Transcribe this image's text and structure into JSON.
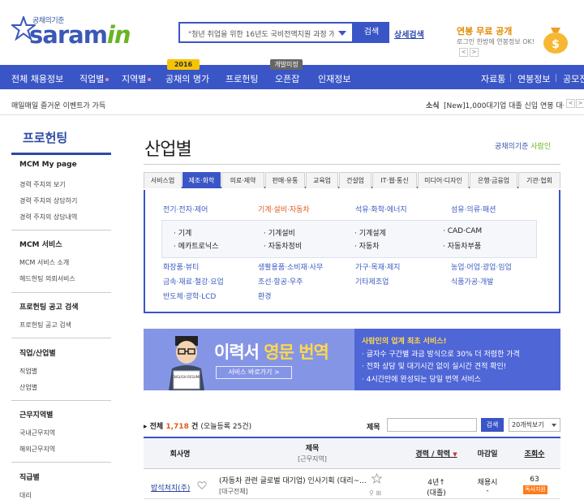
{
  "header": {
    "logo_tagline": "공채의기준",
    "logo_main": "saram",
    "logo_accent": "in",
    "search_value": "\"청년 취업을 위한 16년도 국비전액지원 과정 개설\"",
    "search_button": "검색",
    "detail_search": "상세검색",
    "promo_title": "연봉 무료 공개",
    "promo_sub": "로그인 한방에 연봉정보 OK!",
    "promo_prev": "<",
    "promo_next": ">"
  },
  "nav": {
    "items": [
      "전체 채용정보",
      "직업별",
      "지역별",
      "공채의 명가",
      "프로헌팅",
      "오픈잡",
      "인재정보"
    ],
    "badge_2016": "2016",
    "badge_beta": "개발미정",
    "right_items": [
      "자료통",
      "연봉정보",
      "공모전"
    ]
  },
  "ticker": {
    "left": "매일매일 즐거운 이벤트가 가득",
    "right_label": "소식",
    "right_text": "[New]1,000대기업 대졸 신입 연봉 대공개!",
    "prev": "<",
    "next": ">"
  },
  "sidebar": {
    "title": "프로헌팅",
    "sections": [
      {
        "head": "MCM My page",
        "links": [
          "경력 주치의 보기",
          "경력 주치의 상담하기",
          "경력 주치의 상담내역"
        ]
      },
      {
        "head": "MCM 서비스",
        "links": [
          "MCM 서비스 소개",
          "헤드헌팅 의뢰서비스"
        ]
      },
      {
        "head": "프로헌팅 공고 검색",
        "links": [
          "프로헌팅 공고 검색"
        ]
      },
      {
        "head": "직업/산업별",
        "links": [
          "직업별",
          "산업별"
        ]
      },
      {
        "head": "근무지역별",
        "links": [
          "국내근무지역",
          "해외근무지역"
        ]
      },
      {
        "head": "직급별",
        "links": [
          "대리"
        ]
      }
    ]
  },
  "main": {
    "title": "산업별",
    "brand": "공채의기준",
    "brand_accent": "사람인",
    "tabs": [
      "서비스업",
      "제조·화학",
      "의료·제약",
      "판매·유통",
      "교육업",
      "건설업",
      "IT·웹·통신",
      "미디어·디자인",
      "은행·금융업",
      "기관·협회"
    ],
    "categories_top": [
      "전기·전자·제어",
      "기계·설비·자동차",
      "석유·화학·에너지",
      "섬유·의류·패션"
    ],
    "subcategories": [
      "· 기계",
      "· 기계설비",
      "· 기계설계",
      "· CAD·CAM",
      "· 메카트로닉스",
      "· 자동차정비",
      "· 자동차",
      "· 자동차부품"
    ],
    "categories_bottom": [
      [
        "화장품·뷰티",
        "생활용품·소비재·사무",
        "가구·목재·제지",
        "농업·어업·광업·임업"
      ],
      [
        "금속·재료·철강·요업",
        "조선·항공·우주",
        "기타제조업",
        "식품가공·개발"
      ],
      [
        "반도체·광학·LCD",
        "환경",
        "",
        ""
      ]
    ]
  },
  "banner": {
    "title_white": "이력서",
    "title_yellow": "영문 번역",
    "button": "서비스 바로가기 >",
    "resume_caption": "ENGLISH RESUME",
    "lines": [
      "사람인의 업계 최초 서비스!",
      "· 글자수 구간별 과금 방식으로 30% 더 저렴한 가격",
      "· 전화 상담 및 대기시간 없이 실시간 견적 확인!",
      "· 4시간만에 완성되는 당일 번역 서비스"
    ]
  },
  "list": {
    "total_label": "전체",
    "total_count": "1,718",
    "total_unit": "건",
    "today": "(오늘등록 25건)",
    "search_label": "제목",
    "search_value": "",
    "search_button": "검색",
    "sort_select": "20개씩보기",
    "columns": {
      "company": "회사명",
      "title": "제목",
      "title_sub": "[근무지역]",
      "career": "경력 / 학력",
      "deadline": "마감일",
      "views": "조회수"
    },
    "rows": [
      {
        "company": "밥석쳐치(주)",
        "title": "(자동차 관련 글로벌 대기업) 인사기획 (대리~...",
        "location": "[대구전체]",
        "career": "4년↑",
        "education": "(대졸)",
        "deadline": "채용시",
        "deadline_sub": "-",
        "views": "63",
        "badge": "독사지원"
      }
    ]
  },
  "colors": {
    "primary": "#3a55c6",
    "accent_orange": "#e05a1c",
    "logo_green": "#6ab424"
  }
}
